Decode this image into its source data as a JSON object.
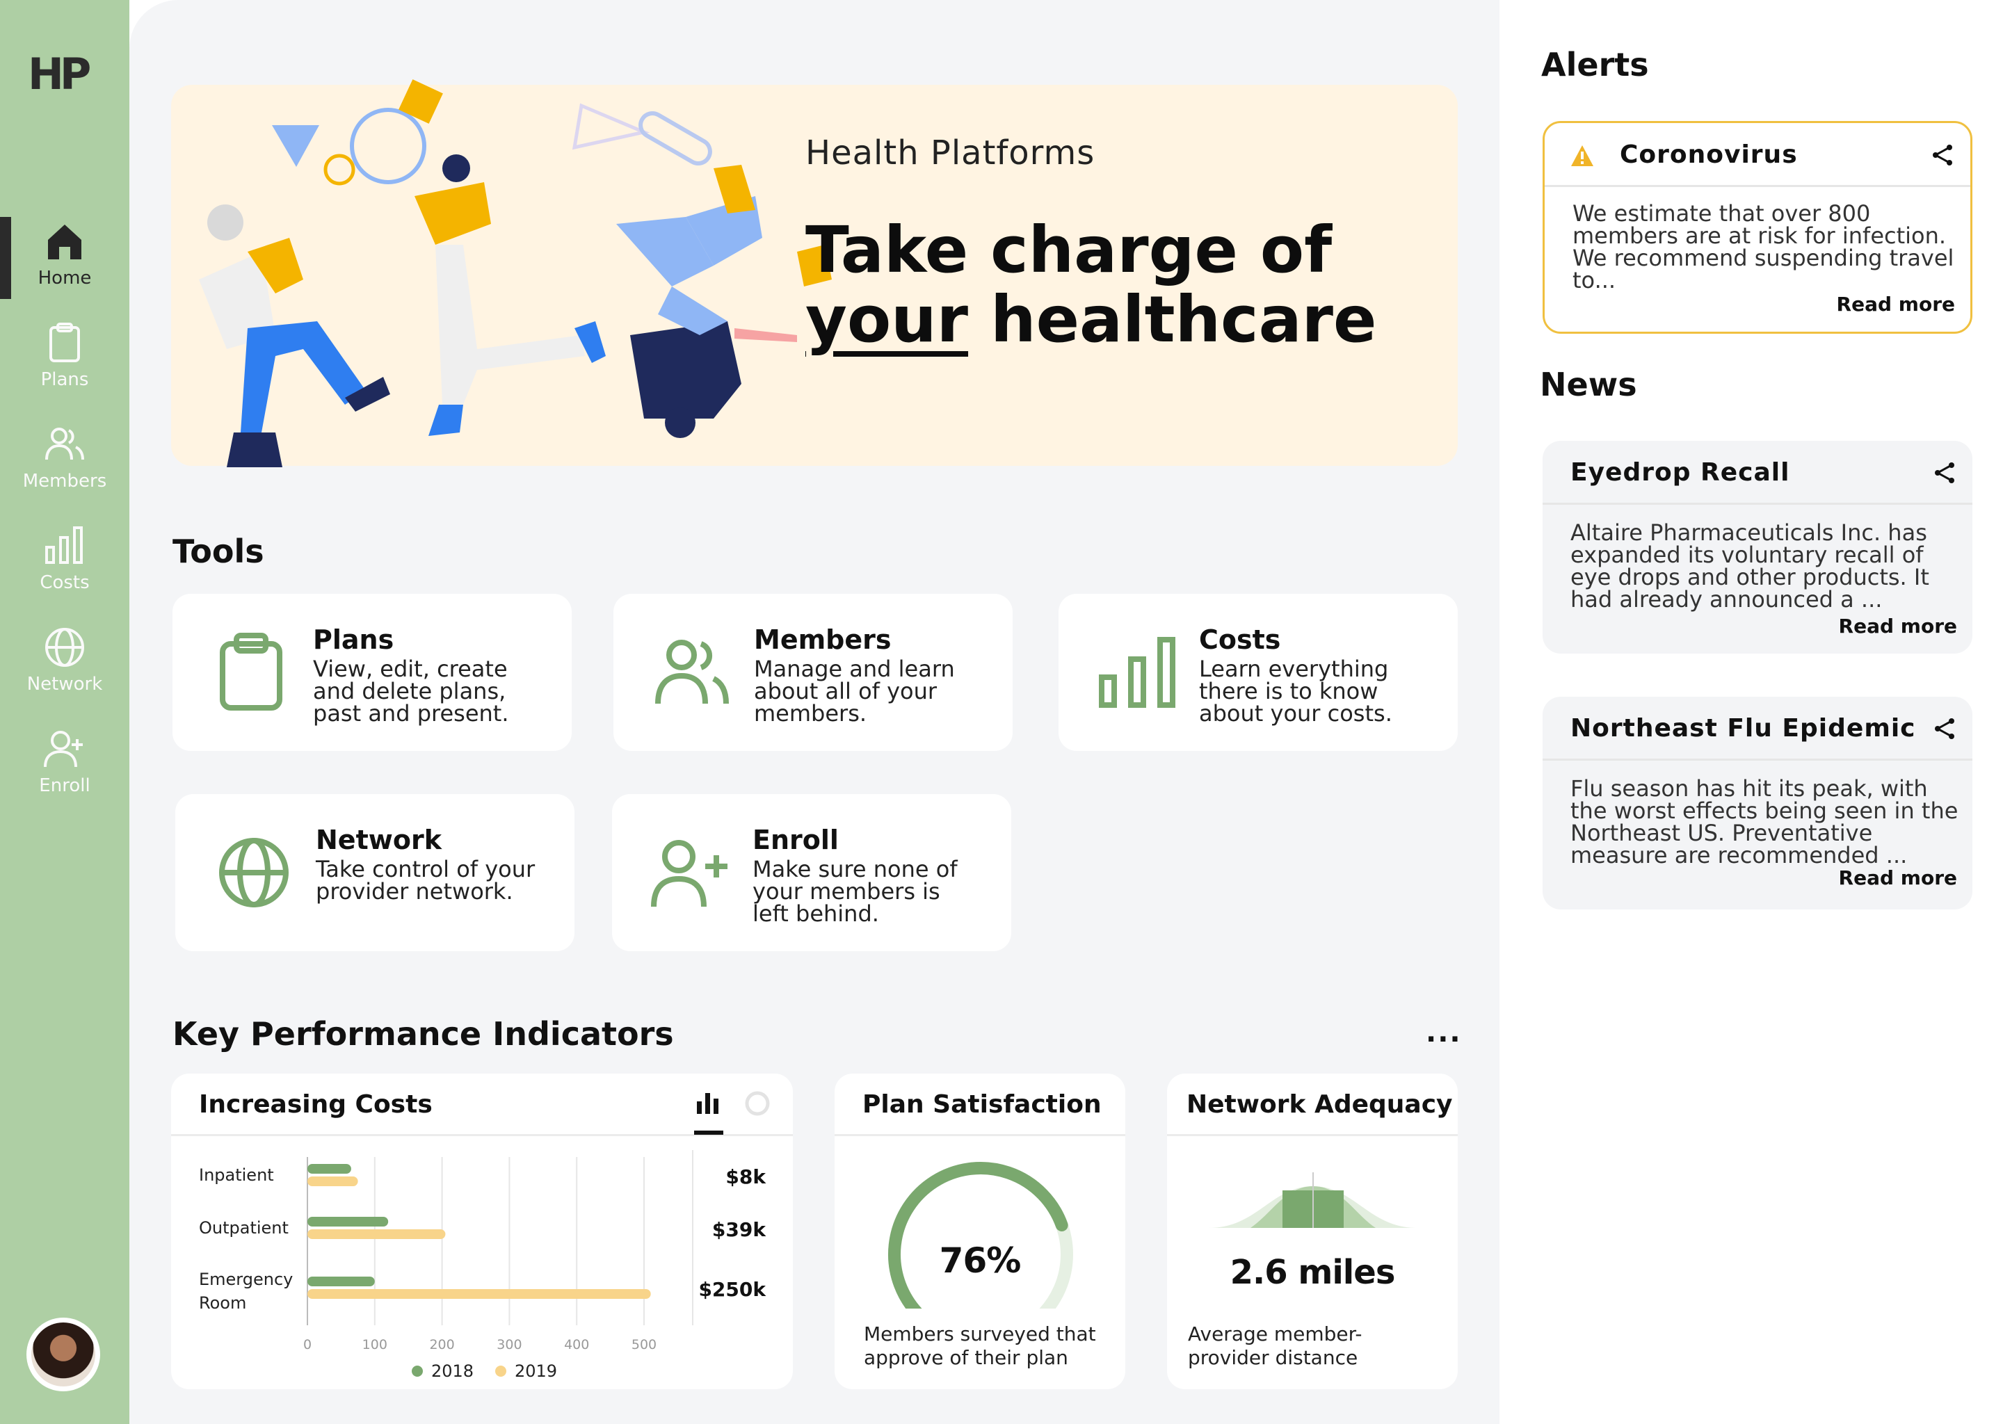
{
  "brand": {
    "logo": "HP"
  },
  "nav": {
    "items": [
      {
        "label": "Home",
        "icon": "home-icon",
        "active": true
      },
      {
        "label": "Plans",
        "icon": "clipboard-icon",
        "active": false
      },
      {
        "label": "Members",
        "icon": "users-icon",
        "active": false
      },
      {
        "label": "Costs",
        "icon": "bar-chart-icon",
        "active": false
      },
      {
        "label": "Network",
        "icon": "globe-icon",
        "active": false
      },
      {
        "label": "Enroll",
        "icon": "user-plus-icon",
        "active": false
      }
    ]
  },
  "hero": {
    "subtitle": "Health Platforms",
    "title_line1": "Take charge of",
    "title_underlined": "your",
    "title_rest": " healthcare"
  },
  "tools": {
    "title": "Tools",
    "cards": [
      {
        "title": "Plans",
        "desc": "View, edit, create and delete plans, past and present.",
        "icon": "clipboard-icon"
      },
      {
        "title": "Members",
        "desc": "Manage and learn about all of your members.",
        "icon": "users-icon"
      },
      {
        "title": "Costs",
        "desc": "Learn everything there is to know about your costs.",
        "icon": "bar-chart-icon"
      },
      {
        "title": "Network",
        "desc": "Take control of your provider network.",
        "icon": "globe-icon"
      },
      {
        "title": "Enroll",
        "desc": "Make sure none of your members is left behind.",
        "icon": "user-plus-icon"
      }
    ]
  },
  "kpi": {
    "title": "Key Performance Indicators",
    "more": "...",
    "costs": {
      "title": "Increasing Costs"
    },
    "satisfaction": {
      "title": "Plan Satisfaction",
      "value": "76%",
      "percent": 76,
      "caption_1": "Members surveyed that",
      "caption_2": "approve of their plan"
    },
    "adequacy": {
      "title": "Network Adequacy",
      "value": "2.6 miles",
      "caption_1": "Average member-",
      "caption_2": "provider distance"
    }
  },
  "chart_data": {
    "type": "bar",
    "orientation": "horizontal",
    "categories": [
      "Inpatient",
      "Outpatient",
      "Emergency Room"
    ],
    "series": [
      {
        "name": "2018",
        "values": [
          65,
          120,
          100
        ],
        "color": "#7aa86e"
      },
      {
        "name": "2019",
        "values": [
          75,
          205,
          510
        ],
        "color": "#f8d48a"
      }
    ],
    "xticks": [
      0,
      100,
      200,
      300,
      400,
      500
    ],
    "xlim": [
      0,
      500
    ],
    "value_labels": [
      "$8k",
      "$39k",
      "$250k"
    ],
    "legend_position": "bottom",
    "grid": true
  },
  "alerts": {
    "title": "Alerts",
    "items": [
      {
        "title": "Coronovirus",
        "body": "We estimate that over 800 members are at risk for infection. We recommend suspending travel to...",
        "read_more": "Read more",
        "icon": "warning-icon"
      }
    ]
  },
  "news": {
    "title": "News",
    "items": [
      {
        "title": "Eyedrop Recall",
        "body": "Altaire Pharmaceuticals Inc. has expanded its voluntary recall of eye drops and other products. It had already announced a ...",
        "read_more": "Read more"
      },
      {
        "title": "Northeast Flu Epidemic",
        "body": "Flu season has hit its peak, with the worst effects being seen in the Northeast US. Preventative measure are recommended ...",
        "read_more": "Read more"
      }
    ]
  },
  "colors": {
    "sidebar": "#aecfa4",
    "accent_green": "#7aa86e",
    "accent_yellow": "#f8d48a",
    "alert_border": "#f0c040"
  }
}
